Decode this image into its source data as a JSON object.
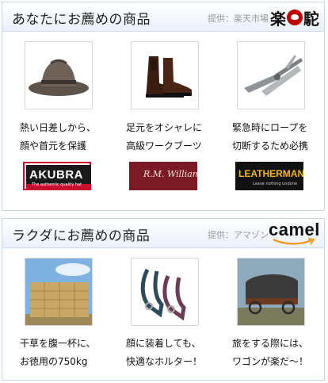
{
  "rakuten_section": {
    "title": "あなたにお薦めの商品",
    "provider": "提供：楽天市場",
    "logo_text": "楽",
    "logo_text2": "駝",
    "items": [
      {
        "line1": "熱い日差しから、",
        "line2": "顔や首元を保護",
        "brand": "AKUBRA",
        "brand_sub": "The authentic quality hat"
      },
      {
        "line1": "足元をオシャレに",
        "line2": "高級ワークブーツ",
        "brand": "R.M. Williams"
      },
      {
        "line1": "緊急時にロープを",
        "line2": "切断するため必携",
        "brand": "LEATHERMAN",
        "brand_sub": "Leave nothing undone"
      }
    ]
  },
  "amazon_section": {
    "title": "ラクダにお薦めの商品",
    "provider": "提供：アマゾン",
    "logo_text": "camel",
    "items": [
      {
        "line1": "干草を腹一杯に、",
        "line2": "お徳用の750kg"
      },
      {
        "line1": "顔に装着しても、",
        "line2": "快適なホルター！"
      },
      {
        "line1": "旅をする際には、",
        "line2": "ワゴンが楽だ〜！"
      }
    ]
  },
  "colors": {
    "rakuten_red": "#bf0000",
    "akubra_red": "#c8102e",
    "rmw_maroon": "#7a1a25",
    "leatherman_yellow": "#f2b705",
    "amazon_orange": "#f29a1d"
  }
}
